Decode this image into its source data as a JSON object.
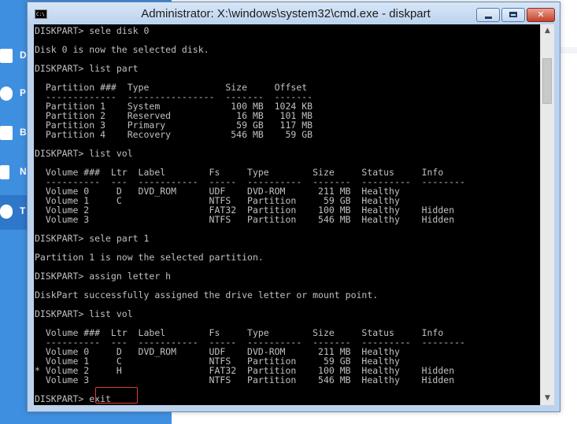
{
  "background_app": {
    "sidebar_letters": [
      "D",
      "P",
      "B",
      "N",
      "T"
    ],
    "colors": {
      "sidebar": "#3f8fe0",
      "active": "#2f77c8"
    }
  },
  "window": {
    "title": "Administrator: X:\\windows\\system32\\cmd.exe - diskpart",
    "icon_text": "C:\\",
    "controls": {
      "minimize": "minimize-icon",
      "maximize": "maximize-icon",
      "close": "✕"
    }
  },
  "console": {
    "lines": [
      "DISKPART> sele disk 0",
      "",
      "Disk 0 is now the selected disk.",
      "",
      "DISKPART> list part",
      "",
      "  Partition ###  Type              Size     Offset",
      "  -------------  ----------------  -------  -------",
      "  Partition 1    System             100 MB  1024 KB",
      "  Partition 2    Reserved            16 MB   101 MB",
      "  Partition 3    Primary             59 GB   117 MB",
      "  Partition 4    Recovery           546 MB    59 GB",
      "",
      "DISKPART> list vol",
      "",
      "  Volume ###  Ltr  Label        Fs     Type        Size     Status     Info",
      "  ----------  ---  -----------  -----  ----------  -------  ---------  --------",
      "  Volume 0     D   DVD_ROM      UDF    DVD-ROM      211 MB  Healthy",
      "  Volume 1     C                NTFS   Partition     59 GB  Healthy",
      "  Volume 2                      FAT32  Partition    100 MB  Healthy    Hidden",
      "  Volume 3                      NTFS   Partition    546 MB  Healthy    Hidden",
      "",
      "DISKPART> sele part 1",
      "",
      "Partition 1 is now the selected partition.",
      "",
      "DISKPART> assign letter h",
      "",
      "DiskPart successfully assigned the drive letter or mount point.",
      "",
      "DISKPART> list vol",
      "",
      "  Volume ###  Ltr  Label        Fs     Type        Size     Status     Info",
      "  ----------  ---  -----------  -----  ----------  -------  ---------  --------",
      "  Volume 0     D   DVD_ROM      UDF    DVD-ROM      211 MB  Healthy",
      "  Volume 1     C                NTFS   Partition     59 GB  Healthy",
      "* Volume 2     H                FAT32  Partition    100 MB  Healthy    Hidden",
      "  Volume 3                      NTFS   Partition    546 MB  Healthy    Hidden",
      "",
      "DISKPART> exit"
    ],
    "colors": {
      "background": "#000000",
      "text": "#c0c0c0",
      "highlight": "#e03c31"
    }
  },
  "scrollbar": {
    "up": "▲",
    "down": "▼"
  }
}
